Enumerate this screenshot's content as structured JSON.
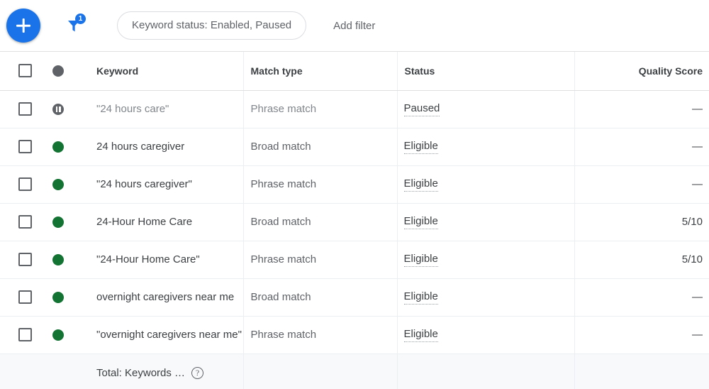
{
  "toolbar": {
    "add_button_label": "+",
    "add_button_icon": "plus-icon",
    "filter_icon": "filter-funnel-icon",
    "filter_badge_count": "1",
    "filter_chip_label": "Keyword status: Enabled, Paused",
    "add_filter_label": "Add filter"
  },
  "colors": {
    "accent_blue": "#1a73e8",
    "status_green": "#137333",
    "status_gray": "#5f6368",
    "text_primary": "#3c4043",
    "text_secondary": "#5f6368",
    "border": "#eceff1",
    "footer_bg": "#f8f9fa"
  },
  "table": {
    "columns": [
      {
        "key": "checkbox",
        "label": ""
      },
      {
        "key": "status_dot",
        "label": ""
      },
      {
        "key": "keyword",
        "label": "Keyword"
      },
      {
        "key": "match_type",
        "label": "Match type"
      },
      {
        "key": "status",
        "label": "Status"
      },
      {
        "key": "quality_score",
        "label": "Quality Score"
      }
    ],
    "header_icons": {
      "select_all": "checkbox-unchecked-icon",
      "status_dot": "circle-filled-icon"
    },
    "rows": [
      {
        "checkbox": "checkbox-unchecked-icon",
        "dot_type": "paused",
        "dot_icon": "pause-circle-icon",
        "keyword": "\"24 hours care\"",
        "match_type": "Phrase match",
        "status": "Paused",
        "quality_score": "—"
      },
      {
        "checkbox": "checkbox-unchecked-icon",
        "dot_type": "enabled",
        "dot_icon": "circle-filled-icon",
        "keyword": "24 hours caregiver",
        "match_type": "Broad match",
        "status": "Eligible",
        "quality_score": "—"
      },
      {
        "checkbox": "checkbox-unchecked-icon",
        "dot_type": "enabled",
        "dot_icon": "circle-filled-icon",
        "keyword": "\"24 hours caregiver\"",
        "match_type": "Phrase match",
        "status": "Eligible",
        "quality_score": "—"
      },
      {
        "checkbox": "checkbox-unchecked-icon",
        "dot_type": "enabled",
        "dot_icon": "circle-filled-icon",
        "keyword": "24-Hour Home Care",
        "match_type": "Broad match",
        "status": "Eligible",
        "quality_score": "5/10"
      },
      {
        "checkbox": "checkbox-unchecked-icon",
        "dot_type": "enabled",
        "dot_icon": "circle-filled-icon",
        "keyword": "\"24-Hour Home Care\"",
        "match_type": "Phrase match",
        "status": "Eligible",
        "quality_score": "5/10"
      },
      {
        "checkbox": "checkbox-unchecked-icon",
        "dot_type": "enabled",
        "dot_icon": "circle-filled-icon",
        "keyword": "overnight caregivers near me",
        "match_type": "Broad match",
        "status": "Eligible",
        "quality_score": "—"
      },
      {
        "checkbox": "checkbox-unchecked-icon",
        "dot_type": "enabled",
        "dot_icon": "circle-filled-icon",
        "keyword": "\"overnight caregivers near me\"",
        "match_type": "Phrase match",
        "status": "Eligible",
        "quality_score": "—"
      }
    ],
    "footer": {
      "total_label": "Total: Keywords …",
      "help_icon": "help-circle-icon",
      "help_glyph": "?",
      "match_type": "",
      "status": "",
      "quality_score": ""
    }
  }
}
